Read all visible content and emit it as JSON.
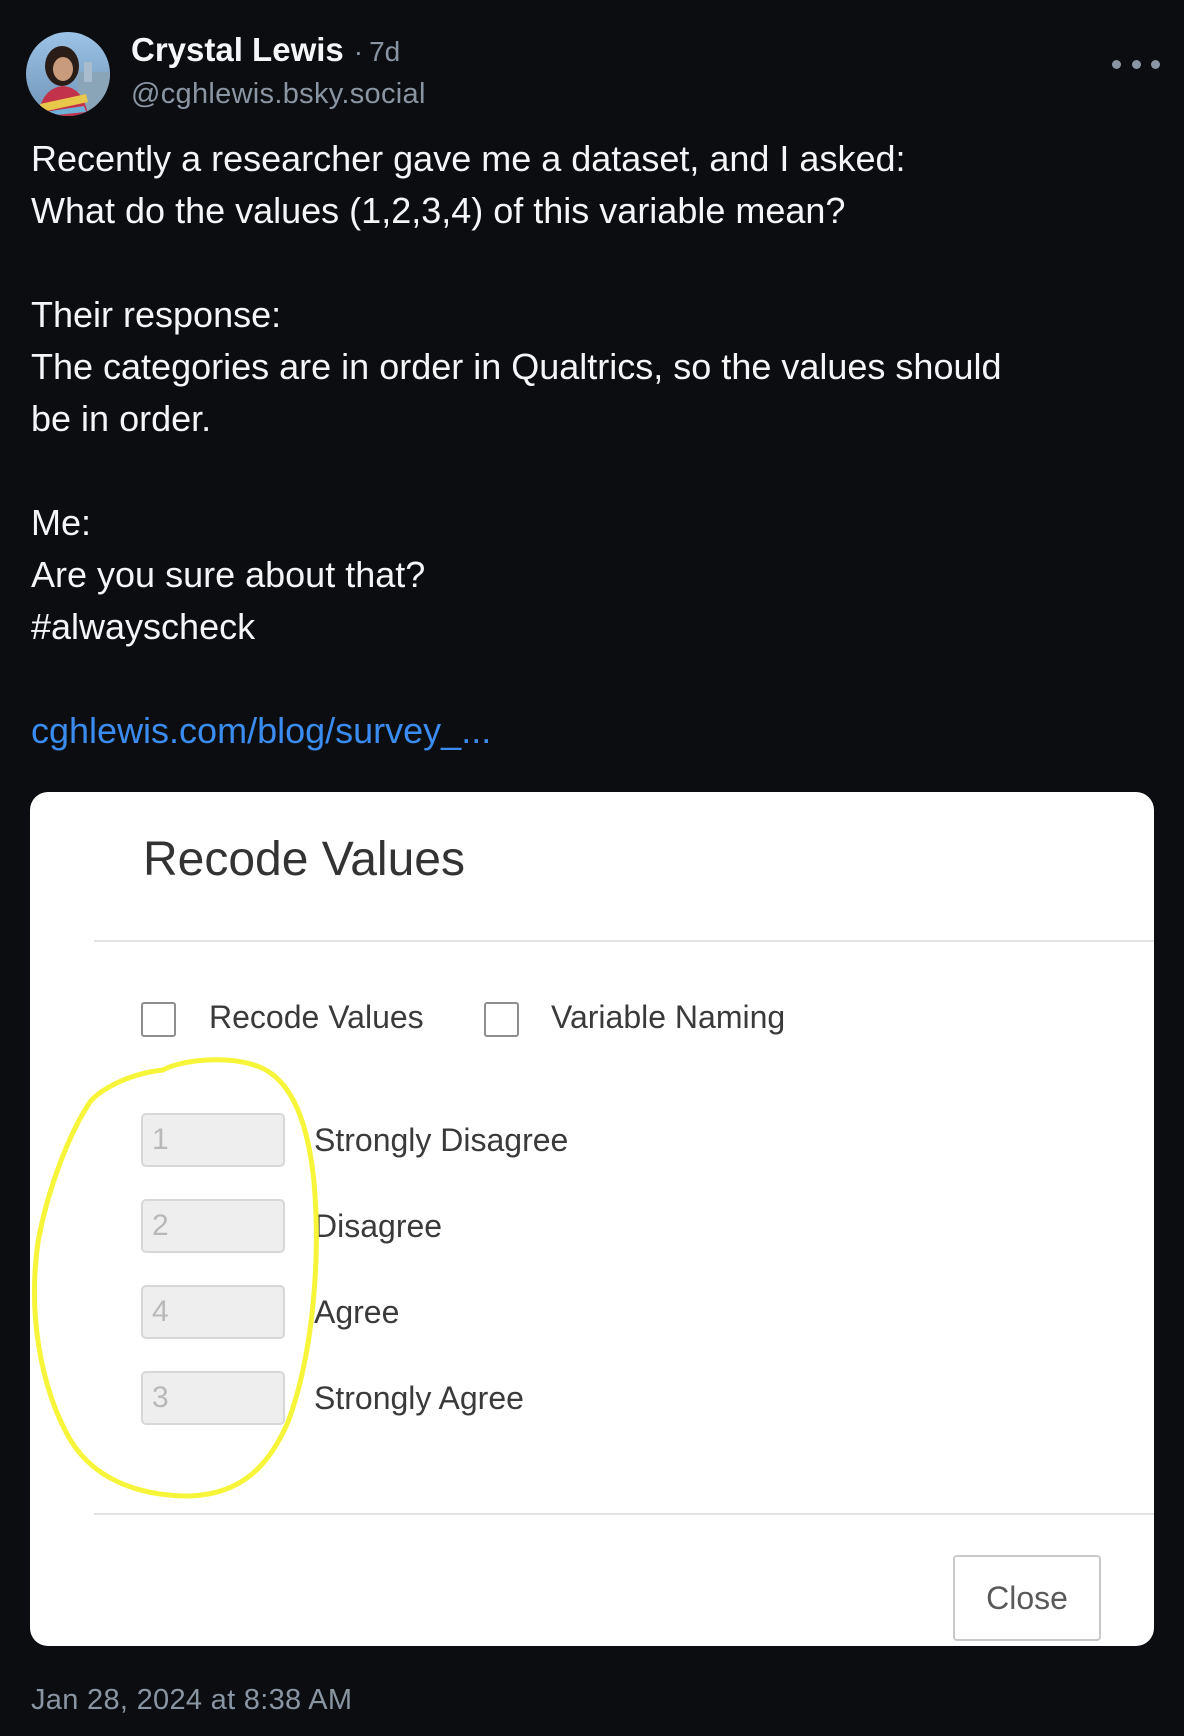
{
  "post": {
    "author_name": "Crystal Lewis",
    "separator": "·",
    "age": "7d",
    "handle": "@cghlewis.bsky.social",
    "text_lines": [
      "Recently a researcher gave me a dataset, and I asked:",
      "What do the values (1,2,3,4) of this variable mean?",
      "Their response:",
      "The categories are in order in Qualtrics, so the values should",
      "be in order.",
      "Me:",
      "Are you sure about that?",
      "#alwayscheck"
    ],
    "link_text": "cghlewis.com/blog/survey_...",
    "timestamp": "Jan 28, 2024 at 8:38 AM",
    "more_icon": "ellipsis-icon"
  },
  "embed": {
    "dialog_title": "Recode Values",
    "checkboxes": [
      {
        "label": "Recode Values",
        "checked": false
      },
      {
        "label": "Variable Naming",
        "checked": false
      }
    ],
    "rows": [
      {
        "value": "1",
        "label": "Strongly Disagree"
      },
      {
        "value": "2",
        "label": "Disagree"
      },
      {
        "value": "4",
        "label": "Agree"
      },
      {
        "value": "3",
        "label": "Strongly Agree"
      }
    ],
    "close_label": "Close",
    "annotation_color": "#f7f53a"
  },
  "colors": {
    "background": "#0c0d10",
    "link": "#3b8cf0",
    "muted": "#8a95a3"
  }
}
